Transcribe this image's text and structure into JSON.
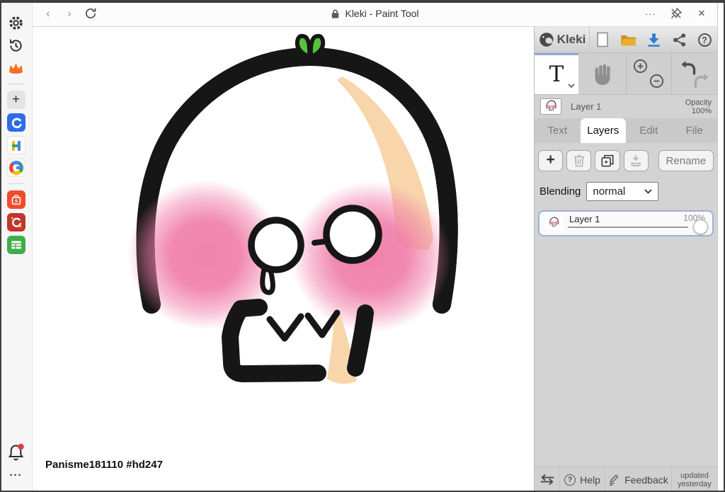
{
  "theme": {
    "ink": "#161616",
    "blush": "#f07fa9",
    "peach": "#f8d5ab",
    "leaf": "#57c23e",
    "accent_blue": "#8fa7d9",
    "download_blue": "#2b7cd3",
    "folder_yellow": "#e9b02c",
    "selected_border": "#9db1d6",
    "notification_red": "#e23c3c"
  },
  "icons": {
    "back": "‹",
    "forward": "›",
    "more": "···",
    "close": "×",
    "overflow": "···",
    "add": "+",
    "help_q": "?",
    "text_tool": "T"
  },
  "window": {
    "title": "Kleki - Paint Tool"
  },
  "canvas_art": {
    "caption": "Panisme181110 #hd247"
  },
  "panel": {
    "brand": "Kleki",
    "layer_preview": {
      "name": "Layer 1",
      "opacity_label": "Opacity",
      "opacity_value": "100%"
    },
    "tabs": [
      {
        "label": "Text"
      },
      {
        "label": "Layers"
      },
      {
        "label": "Edit"
      },
      {
        "label": "File"
      }
    ],
    "layers_tab": {
      "rename": "Rename",
      "blending_label": "Blending",
      "blending_value": "normal",
      "layers": [
        {
          "name": "Layer 1",
          "opacity": "100%"
        }
      ]
    },
    "footer": {
      "help": "Help",
      "feedback": "Feedback",
      "updated_line1": "updated",
      "updated_line2": "yesterday"
    }
  }
}
